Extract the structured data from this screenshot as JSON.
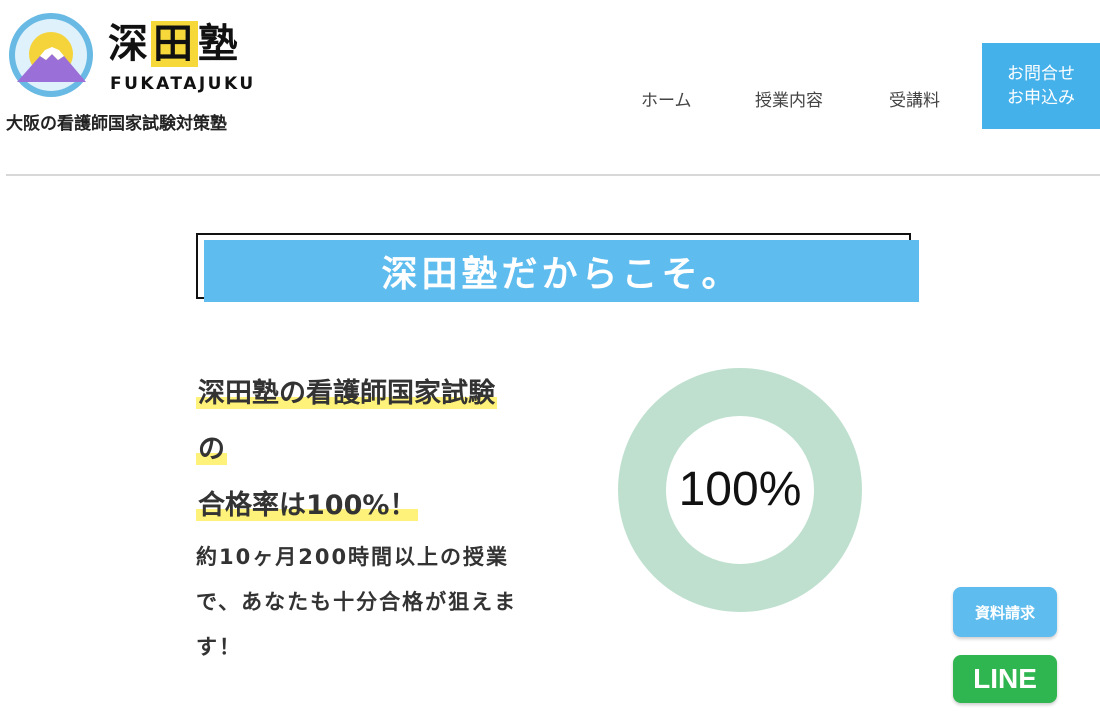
{
  "header": {
    "logo_icon": "mount-fuji-sunrise-logo",
    "logo_title_part1": "深",
    "logo_title_part2": "田",
    "logo_title_part3": "塾",
    "logo_subtitle": "FUKATAJUKU",
    "tagline": "大阪の看護師国家試験対策塾",
    "nav": {
      "home": "ホーム",
      "course": "授業内容",
      "fee": "受講料"
    },
    "contact_line1": "お問合せ",
    "contact_line2": "お申込み"
  },
  "banner": {
    "title": "深田塾だからこそ。"
  },
  "main": {
    "lead_line1": "深田塾の看護師国家試験",
    "lead_line2": "の",
    "lead_line3": "合格率は100%！",
    "description": "約10ヶ月200時間以上の授業で、あなたも十分合格が狙えます！",
    "pass_rate": {
      "value": 100,
      "label": "100%"
    }
  },
  "floating": {
    "document_request": "資料請求",
    "line": "LINE"
  },
  "colors": {
    "accent_blue": "#45b1ea",
    "banner_blue": "#5fbcee",
    "donut_green": "#bfe0cf",
    "highlight_yellow": "#fff27a",
    "line_green": "#2fb650"
  }
}
